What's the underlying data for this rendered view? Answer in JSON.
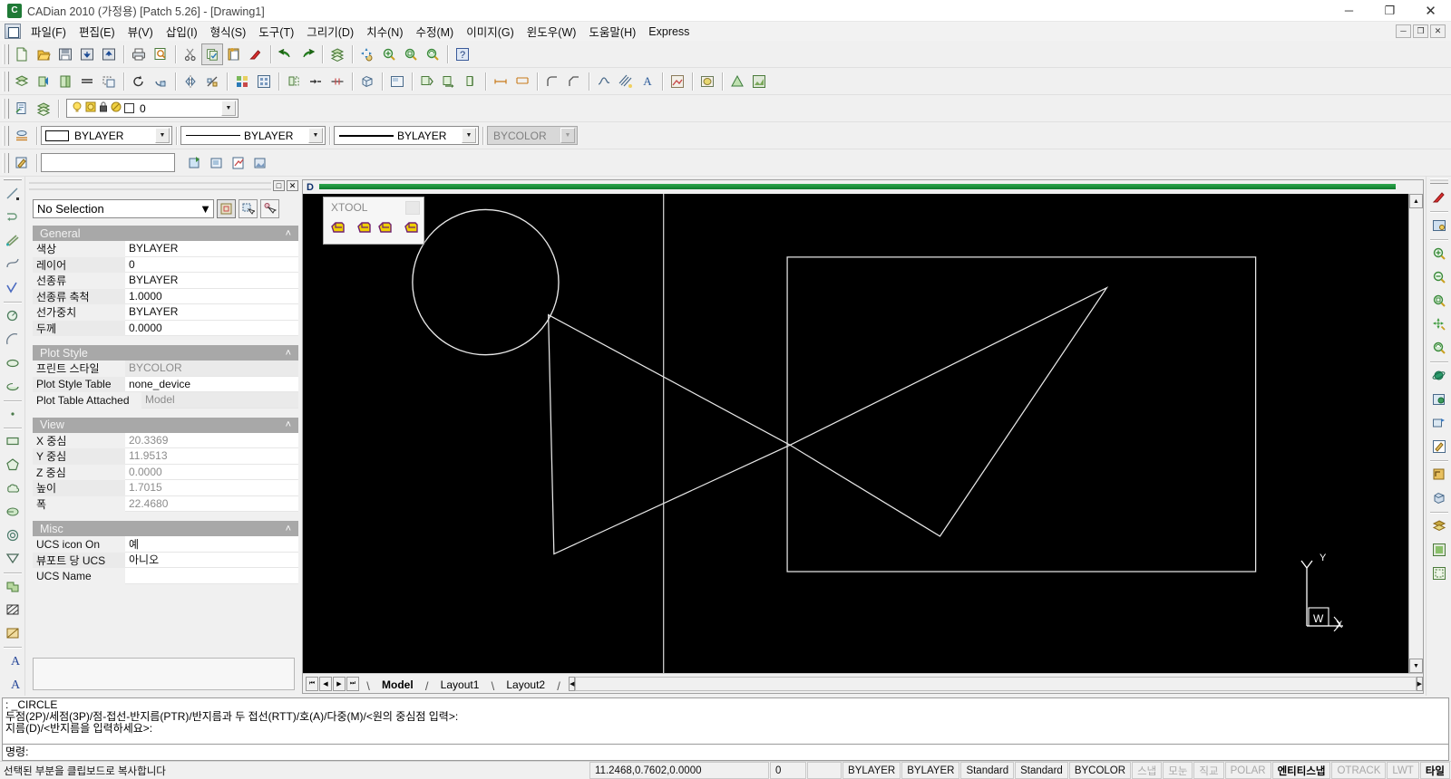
{
  "window": {
    "title": "CADian 2010 (가정용) [Patch 5.26] - [Drawing1]",
    "app_icon": "cadian-logo-icon",
    "minimize": "─",
    "maximize": "❐",
    "close": "✕"
  },
  "menu": {
    "items": [
      {
        "label": "파일(F)"
      },
      {
        "label": "편집(E)"
      },
      {
        "label": "뷰(V)"
      },
      {
        "label": "삽입(I)"
      },
      {
        "label": "형식(S)"
      },
      {
        "label": "도구(T)"
      },
      {
        "label": "그리기(D)"
      },
      {
        "label": "치수(N)"
      },
      {
        "label": "수정(M)"
      },
      {
        "label": "이미지(G)"
      },
      {
        "label": "윈도우(W)"
      },
      {
        "label": "도움말(H)"
      },
      {
        "label": "Express"
      }
    ],
    "doc_buttons": [
      {
        "label": "─",
        "name": "doc-minimize"
      },
      {
        "label": "❐",
        "name": "doc-restore"
      },
      {
        "label": "✕",
        "name": "doc-close"
      }
    ]
  },
  "toolbar_standard": [
    {
      "name": "new-icon"
    },
    {
      "name": "open-icon"
    },
    {
      "name": "save-icon"
    },
    {
      "name": "export-icon"
    },
    {
      "name": "import-icon"
    },
    {
      "sep": true
    },
    {
      "name": "print-icon"
    },
    {
      "name": "print-preview-icon"
    },
    {
      "sep": true
    },
    {
      "name": "cut-icon"
    },
    {
      "name": "copy-icon",
      "pressed": true
    },
    {
      "name": "paste-icon"
    },
    {
      "name": "match-properties-icon"
    },
    {
      "sep": true
    },
    {
      "name": "undo-icon"
    },
    {
      "name": "redo-icon"
    },
    {
      "sep": true
    },
    {
      "name": "layers-icon"
    },
    {
      "sep": true
    },
    {
      "name": "pan-icon"
    },
    {
      "name": "zoom-in-icon"
    },
    {
      "name": "zoom-window-icon"
    },
    {
      "name": "zoom-realtime-icon"
    },
    {
      "sep": true
    },
    {
      "name": "help-icon"
    }
  ],
  "toolbar_modify": [
    {
      "name": "layer-properties-icon"
    },
    {
      "name": "layer-prev-icon"
    },
    {
      "name": "layer-make-icon"
    },
    {
      "name": "erase-icon"
    },
    {
      "name": "copy-object-icon"
    },
    {
      "sep": true
    },
    {
      "name": "rotate-icon"
    },
    {
      "name": "move-icon"
    },
    {
      "sep": true
    },
    {
      "name": "mirror-icon"
    },
    {
      "name": "scale-icon"
    },
    {
      "sep": true
    },
    {
      "name": "array-icon"
    },
    {
      "name": "block-icon"
    },
    {
      "sep": true
    },
    {
      "name": "offset-icon"
    },
    {
      "name": "stretch-icon"
    },
    {
      "name": "trim-icon"
    },
    {
      "sep": true
    },
    {
      "name": "3dbox-icon"
    },
    {
      "sep": true
    },
    {
      "name": "viewport-icon"
    },
    {
      "sep": true
    },
    {
      "name": "explode-icon"
    },
    {
      "name": "extend-icon"
    },
    {
      "name": "break-icon"
    },
    {
      "sep": true
    },
    {
      "name": "dim-linear-icon"
    },
    {
      "name": "dim-aligned-icon"
    },
    {
      "sep": true
    },
    {
      "name": "fillet-icon"
    },
    {
      "name": "chamfer-icon"
    },
    {
      "sep": true
    },
    {
      "name": "spline-icon"
    },
    {
      "name": "hatch-edit-icon"
    },
    {
      "name": "text-edit-icon"
    },
    {
      "sep": true
    },
    {
      "name": "render-icon"
    },
    {
      "sep": true
    },
    {
      "name": "shade-icon"
    },
    {
      "sep": true
    },
    {
      "name": "solid-cone-icon"
    },
    {
      "name": "material-icon"
    }
  ],
  "toolbar_layer": {
    "left_icons": [
      {
        "name": "layer-manager-icon"
      },
      {
        "name": "layer-states-icon"
      }
    ],
    "layer_value": "0",
    "layer_state_icons": [
      "lightbulb-icon",
      "freeze-icon",
      "lock-icon",
      "plot-icon",
      "color-swatch-icon"
    ]
  },
  "toolbar_properties": {
    "icon": {
      "name": "properties-icon"
    },
    "color": {
      "value": "BYLAYER",
      "name": "color-combo"
    },
    "linetype": {
      "value": "BYLAYER",
      "name": "linetype-combo"
    },
    "lineweight": {
      "value": "BYLAYER",
      "name": "lineweight-combo"
    },
    "plotstyle": {
      "value": "BYCOLOR",
      "name": "plotstyle-combo",
      "disabled": true
    }
  },
  "toolbar_insert": {
    "icon": {
      "name": "edit-block-icon"
    },
    "field_value": "",
    "buttons": [
      {
        "name": "insert-block-icon"
      },
      {
        "name": "make-block-icon"
      },
      {
        "name": "xref-icon"
      },
      {
        "name": "image-attach-icon"
      }
    ]
  },
  "left_toolbar": [
    {
      "name": "line-icon"
    },
    {
      "name": "polyline-icon"
    },
    {
      "name": "multiline-icon"
    },
    {
      "name": "spline-curve-icon"
    },
    {
      "name": "sketch-icon"
    },
    {
      "sep": true
    },
    {
      "name": "circle-icon"
    },
    {
      "name": "arc-icon"
    },
    {
      "name": "ellipse-icon"
    },
    {
      "name": "ellipse-arc-icon"
    },
    {
      "sep": true
    },
    {
      "name": "point-icon"
    },
    {
      "sep": true
    },
    {
      "name": "rectangle-icon"
    },
    {
      "name": "polygon-icon"
    },
    {
      "name": "revcloud-icon"
    },
    {
      "name": "donut-shape-icon"
    },
    {
      "name": "donut-icon"
    },
    {
      "name": "wipeout-icon"
    },
    {
      "sep": true
    },
    {
      "name": "block-insert-icon"
    },
    {
      "name": "hatch-icon"
    },
    {
      "name": "gradient-icon"
    },
    {
      "sep": true
    },
    {
      "name": "mtext-icon"
    },
    {
      "name": "text-icon"
    }
  ],
  "right_toolbar": [
    {
      "name": "redraw-icon"
    },
    {
      "sep": true
    },
    {
      "name": "named-views-icon"
    },
    {
      "sep": true
    },
    {
      "name": "zoom-in-icon"
    },
    {
      "name": "zoom-out-icon"
    },
    {
      "name": "zoom-window-icon"
    },
    {
      "name": "pan-icon"
    },
    {
      "name": "zoom-realtime-icon"
    },
    {
      "sep": true
    },
    {
      "name": "3d-orbit-icon"
    },
    {
      "name": "3d-views-icon"
    },
    {
      "name": "3d-pan-icon"
    },
    {
      "name": "viewport-edit-icon"
    },
    {
      "sep": true
    },
    {
      "name": "ucs-icon"
    },
    {
      "name": "ucs-3d-icon"
    },
    {
      "sep": true
    },
    {
      "name": "render-shade-icon"
    },
    {
      "name": "flat-shade-icon"
    },
    {
      "name": "hidden-line-icon"
    }
  ],
  "properties_panel": {
    "titlebar": {
      "restore_label": "□",
      "close_label": "✕"
    },
    "selection": {
      "value": "No Selection",
      "buttons": [
        {
          "name": "quick-select-icon"
        },
        {
          "name": "select-objects-icon"
        },
        {
          "name": "pick-point-icon"
        }
      ]
    },
    "groups": [
      {
        "title": "General",
        "collapse": "˄",
        "rows": [
          {
            "key": "색상",
            "value": "BYLAYER",
            "gray": false
          },
          {
            "key": "레이어",
            "value": "0",
            "gray": false
          },
          {
            "key": "선종류",
            "value": "BYLAYER",
            "gray": false
          },
          {
            "key": "선종류 축척",
            "value": "1.0000",
            "gray": false
          },
          {
            "key": "선가중치",
            "value": "BYLAYER",
            "gray": false
          },
          {
            "key": "두께",
            "value": "0.0000",
            "gray": false
          }
        ]
      },
      {
        "title": "Plot Style",
        "collapse": "˄",
        "rows": [
          {
            "key": "프린트 스타일",
            "value": "BYCOLOR",
            "gray": true
          },
          {
            "key": "Plot Style Table",
            "value": "none_device",
            "gray": false
          },
          {
            "key": "Plot Table Attached",
            "value": "Model",
            "gray": true
          }
        ]
      },
      {
        "title": "View",
        "collapse": "˄",
        "rows": [
          {
            "key": "X 중심",
            "value": "20.3369",
            "gray": true
          },
          {
            "key": "Y 중심",
            "value": "11.9513",
            "gray": true
          },
          {
            "key": "Z 중심",
            "value": "0.0000",
            "gray": true
          },
          {
            "key": "높이",
            "value": "1.7015",
            "gray": true
          },
          {
            "key": "폭",
            "value": "22.4680",
            "gray": true
          }
        ]
      },
      {
        "title": "Misc",
        "collapse": "˄",
        "rows": [
          {
            "key": "UCS icon On",
            "value": "예",
            "gray": false
          },
          {
            "key": "뷰포트 당 UCS",
            "value": "아니오",
            "gray": false
          },
          {
            "key": "UCS Name",
            "value": "",
            "gray": false
          }
        ]
      }
    ]
  },
  "drawing_window": {
    "title": "Drawing1",
    "xtool": {
      "title": "XTOOL",
      "buttons": [
        {
          "name": "xtool-button-1"
        },
        {
          "name": "xtool-button-2"
        },
        {
          "name": "xtool-button-3"
        },
        {
          "name": "xtool-button-4"
        }
      ]
    },
    "ucs_icon": {
      "x_label": "X",
      "y_label": "Y",
      "w_label": "W"
    },
    "tabs": [
      {
        "label": "Model",
        "active": true
      },
      {
        "label": "Layout1",
        "active": false
      },
      {
        "label": "Layout2",
        "active": false
      }
    ],
    "nav_buttons": [
      {
        "label": "⏮",
        "name": "tab-first-button"
      },
      {
        "label": "◀",
        "name": "tab-prev-button"
      },
      {
        "label": "▶",
        "name": "tab-next-button"
      },
      {
        "label": "⏭",
        "name": "tab-last-button"
      }
    ]
  },
  "command_line": {
    "lines": [
      ": _CIRCLE",
      "두점(2P)/세점(3P)/점-접선-반지름(PTR)/반지름과 두 접선(RTT)/호(A)/다중(M)/<원의 중심점 입력>:",
      "지름(D)/<반지름을 입력하세요>:"
    ],
    "prompt": "명령:"
  },
  "status_bar": {
    "message": "선택된 부분을 클립보드로 복사합니다",
    "coordinates": "11.2468,0.7602,0.0000",
    "layer_num": "0",
    "blank": "",
    "cells": [
      {
        "label": "BYLAYER",
        "state": "normal"
      },
      {
        "label": "BYLAYER",
        "state": "normal"
      },
      {
        "label": "Standard",
        "state": "normal"
      },
      {
        "label": "Standard",
        "state": "normal"
      },
      {
        "label": "BYCOLOR",
        "state": "normal"
      },
      {
        "label": "스냅",
        "state": "dim"
      },
      {
        "label": "모눈",
        "state": "dim"
      },
      {
        "label": "직교",
        "state": "dim"
      },
      {
        "label": "POLAR",
        "state": "dim"
      },
      {
        "label": "엔티티스냅",
        "state": "bold"
      },
      {
        "label": "OTRACK",
        "state": "dim"
      },
      {
        "label": "LWT",
        "state": "dim"
      },
      {
        "label": "타일",
        "state": "bold"
      }
    ]
  },
  "colors": {
    "canvas_bg": "#000000",
    "geometry_stroke": "#e8e8e8",
    "chrome_bg": "#f0f0f0",
    "group_header": "#a8a8a8",
    "title_accent": "#0d7a2c"
  }
}
